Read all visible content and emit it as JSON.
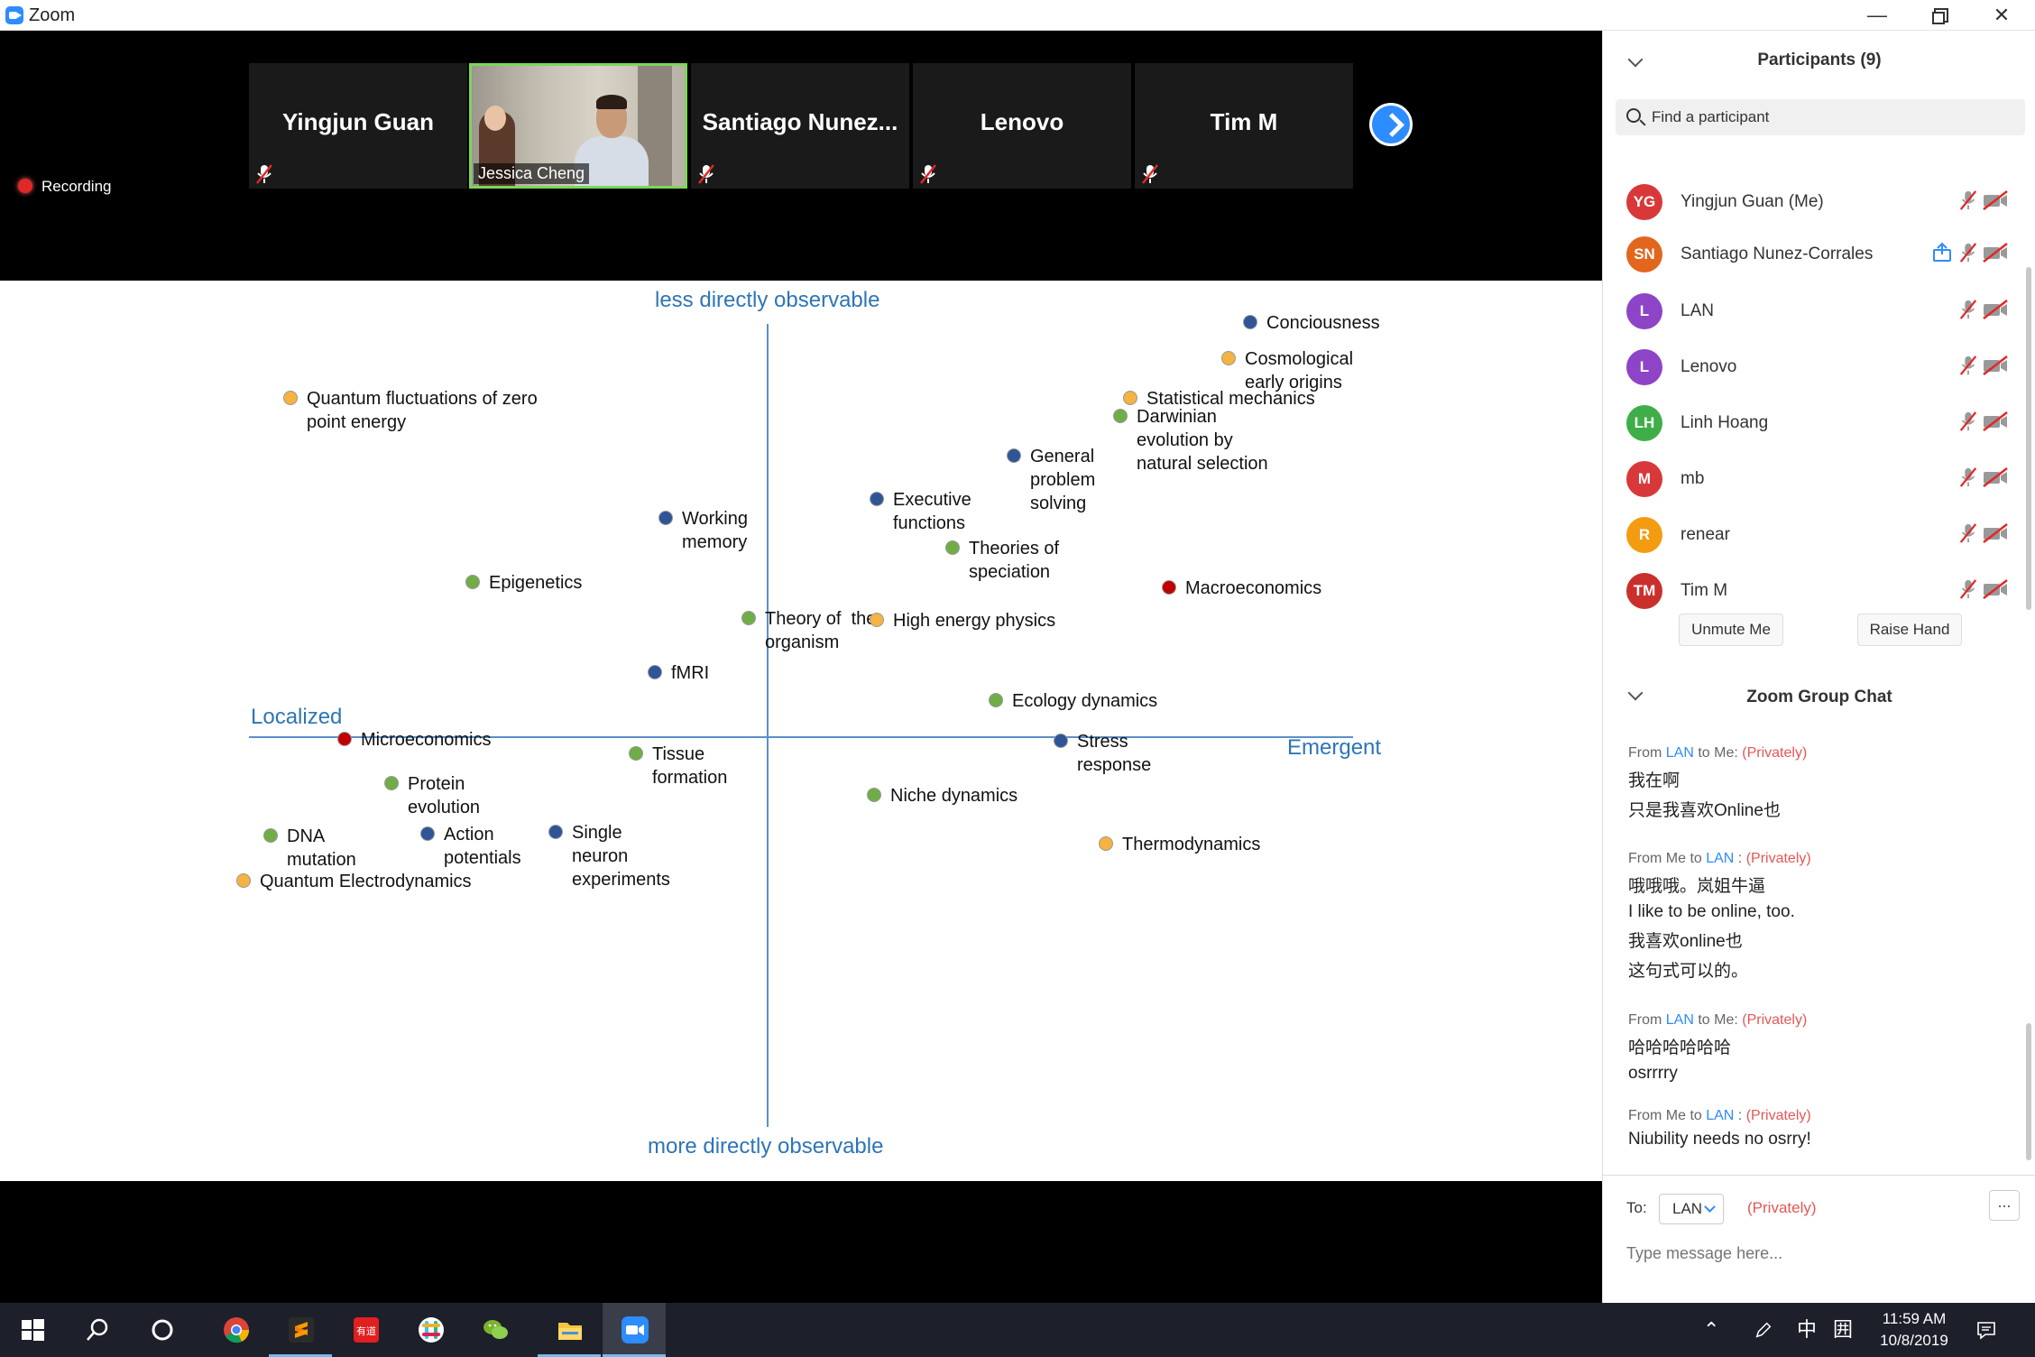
{
  "window": {
    "title": "Zoom",
    "controls": [
      "minimize",
      "restore",
      "close"
    ]
  },
  "video_strip": {
    "tiles": [
      {
        "name": "Yingjun Guan",
        "muted": true,
        "video": false
      },
      {
        "name": "Jessica Cheng",
        "muted": false,
        "video": true
      },
      {
        "name": "Santiago  Nunez...",
        "muted": true,
        "video": false
      },
      {
        "name": "Lenovo",
        "muted": true,
        "video": false
      },
      {
        "name": "Tim M",
        "muted": true,
        "video": false
      }
    ],
    "recording_label": "Recording"
  },
  "slide": {
    "axes": {
      "top": "less directly observable",
      "bottom": "more directly observable",
      "left": "Localized",
      "right": "Emergent"
    },
    "points": [
      {
        "label": "Conciousness",
        "color": "#2f5597"
      },
      {
        "label": "Cosmological\nearly origins",
        "color": "#f4b342"
      },
      {
        "label": "Quantum fluctuations of zero\npoint energy",
        "color": "#f4b342"
      },
      {
        "label": "Statistical mechanics",
        "color": "#f4b342"
      },
      {
        "label": "Darwinian\nevolution by\nnatural selection",
        "color": "#70ad47"
      },
      {
        "label": "General\nproblem\nsolving",
        "color": "#2f5597"
      },
      {
        "label": "Executive\nfunctions",
        "color": "#2f5597"
      },
      {
        "label": "Working\nmemory",
        "color": "#2f5597"
      },
      {
        "label": "Theories of\nspeciation",
        "color": "#70ad47"
      },
      {
        "label": "Epigenetics",
        "color": "#70ad47"
      },
      {
        "label": "Macroeconomics",
        "color": "#c00000"
      },
      {
        "label": "Theory of  the\norganism",
        "color": "#70ad47"
      },
      {
        "label": "High energy physics",
        "color": "#f4b342"
      },
      {
        "label": "fMRI",
        "color": "#2f5597"
      },
      {
        "label": "Ecology dynamics",
        "color": "#70ad47"
      },
      {
        "label": "Microeconomics",
        "color": "#c00000"
      },
      {
        "label": "Tissue\nformation",
        "color": "#70ad47"
      },
      {
        "label": "Stress\nresponse",
        "color": "#2f5597"
      },
      {
        "label": "Protein\nevolution",
        "color": "#70ad47"
      },
      {
        "label": "Niche dynamics",
        "color": "#70ad47"
      },
      {
        "label": "DNA\nmutation",
        "color": "#70ad47"
      },
      {
        "label": "Action\npotentials",
        "color": "#2f5597"
      },
      {
        "label": "Single\nneuron\nexperiments",
        "color": "#2f5597"
      },
      {
        "label": "Thermodynamics",
        "color": "#f4b342"
      },
      {
        "label": "Quantum Electrodynamics",
        "color": "#f4b342"
      }
    ]
  },
  "participants": {
    "header": "Participants (9)",
    "search_placeholder": "Find a participant",
    "list": [
      {
        "initials": "YG",
        "name": "Yingjun Guan (Me)",
        "color": "#d9383a",
        "share": false
      },
      {
        "initials": "SN",
        "name": "Santiago Nunez-Corrales",
        "color": "#e2661e",
        "share": true
      },
      {
        "initials": "L",
        "name": "LAN",
        "color": "#8e44c6",
        "share": false
      },
      {
        "initials": "L",
        "name": "Lenovo",
        "color": "#8e44c6",
        "share": false
      },
      {
        "initials": "LH",
        "name": "Linh Hoang",
        "color": "#3fae49",
        "share": false
      },
      {
        "initials": "M",
        "name": "mb",
        "color": "#d9383a",
        "share": false
      },
      {
        "initials": "R",
        "name": "renear",
        "color": "#f39c12",
        "share": false
      },
      {
        "initials": "TM",
        "name": "Tim M",
        "color": "#c9302c",
        "share": false
      }
    ],
    "unmute_label": "Unmute Me",
    "raise_hand_label": "Raise Hand"
  },
  "chat": {
    "header": "Zoom Group Chat",
    "messages": [
      {
        "prefix": "From ",
        "who": "LAN",
        "suffix": "  to Me: ",
        "priv": "(Privately)",
        "lines": [
          "我在啊",
          "只是我喜欢Online也"
        ]
      },
      {
        "prefix": "From Me to ",
        "who": "LAN",
        "suffix": " : ",
        "priv": "(Privately)",
        "lines": [
          "哦哦哦。岚姐牛逼",
          "I like to be online, too.",
          "我喜欢online也",
          "这句式可以的。"
        ]
      },
      {
        "prefix": "From ",
        "who": "LAN",
        "suffix": "  to Me: ",
        "priv": "(Privately)",
        "lines": [
          "哈哈哈哈哈哈",
          "osrrrry"
        ]
      },
      {
        "prefix": "From Me to ",
        "who": "LAN",
        "suffix": " : ",
        "priv": "(Privately)",
        "lines": [
          "Niubility needs no osrry!"
        ]
      }
    ],
    "to_label": "To:",
    "to_value": "LAN",
    "to_priv": "(Privately)",
    "input_placeholder": "Type message here...",
    "more_label": "..."
  },
  "taskbar": {
    "apps": [
      "windows-start",
      "search",
      "cortana",
      "chrome",
      "sublime-text",
      "youdao",
      "slack",
      "wechat",
      "file-explorer",
      "zoom"
    ],
    "ime_label": "中",
    "ime_mode": "囲",
    "time": "11:59 AM",
    "date": "10/8/2019"
  }
}
